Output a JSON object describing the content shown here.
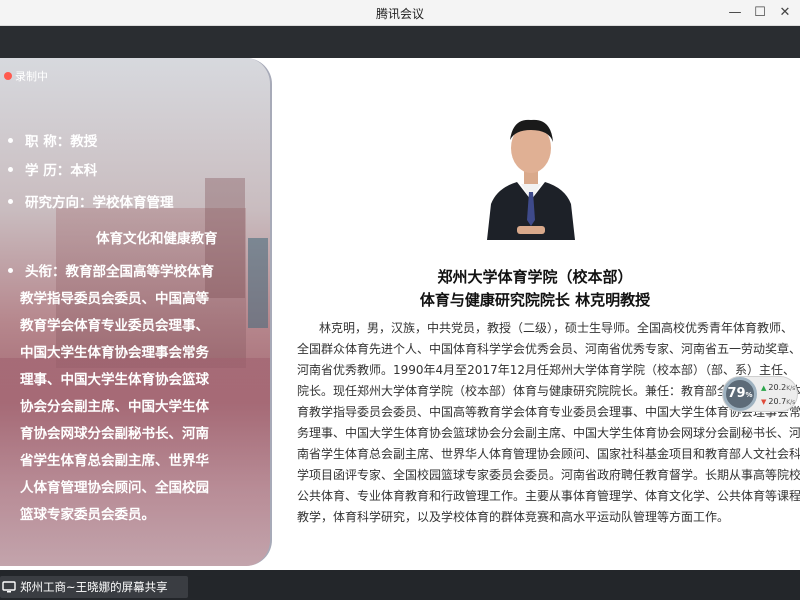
{
  "window": {
    "title": "腾讯会议",
    "min_symbol": "—",
    "max_symbol": "☐",
    "close_symbol": "✕"
  },
  "recording": {
    "label": "录制中",
    "dot_color": "#ff5a4f"
  },
  "left_panel": {
    "lines": [
      "职 称：教授",
      "学 历：本科",
      "研究方向：学校体育管理",
      "体育文化和健康教育",
      "头衔：教育部全国高等学校体育",
      "教学指导委员会委员、中国高等",
      "教育学会体育专业委员会理事、",
      "中国大学生体育协会理事会常务",
      "理事、中国大学生体育协会篮球",
      "协会分会副主席、中国大学生体",
      "育协会网球分会副秘书长、河南",
      "省学生体育总会副主席、世界华",
      "人体育管理协会顾问、全国校园",
      "篮球专家委员会委员。"
    ]
  },
  "slide": {
    "heading1": "郑州大学体育学院（校本部）",
    "heading2": "体育与健康研究院院长  林克明教授",
    "bio": "林克明，男，汉族，中共党员，教授（二级），硕士生导师。全国高校优秀青年体育教师、全国群众体育先进个人、中国体育科学学会优秀会员、河南省优秀专家、河南省五一劳动奖章、河南省优秀教师。1990年4月至2017年12月任郑州大学体育学院（校本部）（部、系）主任、院长。现任郑州大学体育学院（校本部）体育与健康研究院院长。兼任：教育部全国高等学校体育教学指导委员会委员、中国高等教育学会体育专业委员会理事、中国大学生体育协会理事会常务理事、中国大学生体育协会篮球协会分会副主席、中国大学生体育协会网球分会副秘书长、河南省学生体育总会副主席、世界华人体育管理协会顾问、国家社科基金项目和教育部人文社会科学项目函评专家、全国校园篮球专家委员会委员。河南省政府聘任教育督学。长期从事高等院校公共体育、专业体育教育和行政管理工作。主要从事体育管理学、体育文化学、公共体育等课程教学，体育科学研究，以及学校体育的群体竞赛和高水平运动队管理等方面工作。"
  },
  "network": {
    "percent": "79",
    "percent_unit": "%",
    "up_speed": "20.2",
    "down_speed": "20.7",
    "unit": "K/s"
  },
  "share": {
    "label": "郑州工商~王晓娜的屏幕共享"
  }
}
